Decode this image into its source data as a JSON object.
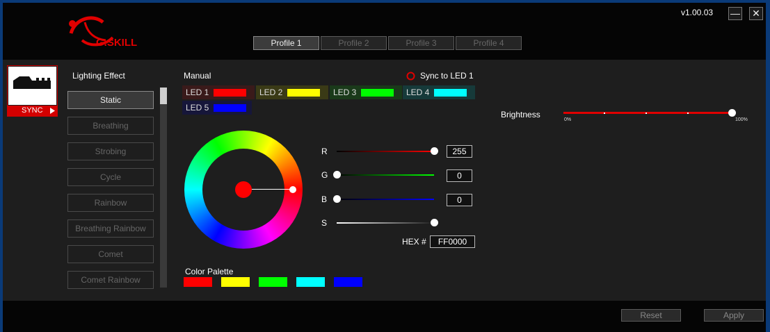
{
  "brand": "G.SKILL",
  "version": "v1.00.03",
  "window": {
    "minimize_glyph": "—",
    "close_glyph": "✕"
  },
  "profiles": [
    {
      "label": "Profile 1",
      "active": true
    },
    {
      "label": "Profile 2",
      "active": false
    },
    {
      "label": "Profile 3",
      "active": false
    },
    {
      "label": "Profile 4",
      "active": false
    }
  ],
  "device": {
    "sync_label": "SYNC"
  },
  "lighting": {
    "title": "Lighting Effect",
    "effects": [
      "Static",
      "Breathing",
      "Strobing",
      "Cycle",
      "Rainbow",
      "Breathing Rainbow",
      "Comet",
      "Comet Rainbow"
    ],
    "selected": "Static"
  },
  "manual": {
    "title": "Manual",
    "sync_to_led": "Sync to LED 1",
    "leds": [
      {
        "label": "LED 1",
        "color": "#ff0000",
        "bg": "#3a1a1a"
      },
      {
        "label": "LED 2",
        "color": "#ffff00",
        "bg": "#3a3a16"
      },
      {
        "label": "LED 3",
        "color": "#00ff00",
        "bg": "#1a3a1a"
      },
      {
        "label": "LED 4",
        "color": "#00ffff",
        "bg": "#163a3a"
      },
      {
        "label": "LED 5",
        "color": "#0000ff",
        "bg": "#16163a"
      }
    ]
  },
  "color": {
    "r_label": "R",
    "g_label": "G",
    "b_label": "B",
    "s_label": "S",
    "r": "255",
    "g": "0",
    "b": "0",
    "r_level": 1,
    "g_level": 0,
    "b_level": 0,
    "s_level": 1,
    "hex_label": "HEX #",
    "hex": "FF0000"
  },
  "palette": {
    "title": "Color Palette",
    "colors": [
      "#ff0000",
      "#ffff00",
      "#00ff00",
      "#00ffff",
      "#0000ff"
    ]
  },
  "brightness": {
    "label": "Brightness",
    "min_label": "0%",
    "max_label": "100%",
    "level": 1
  },
  "footer": {
    "reset": "Reset",
    "apply": "Apply"
  }
}
